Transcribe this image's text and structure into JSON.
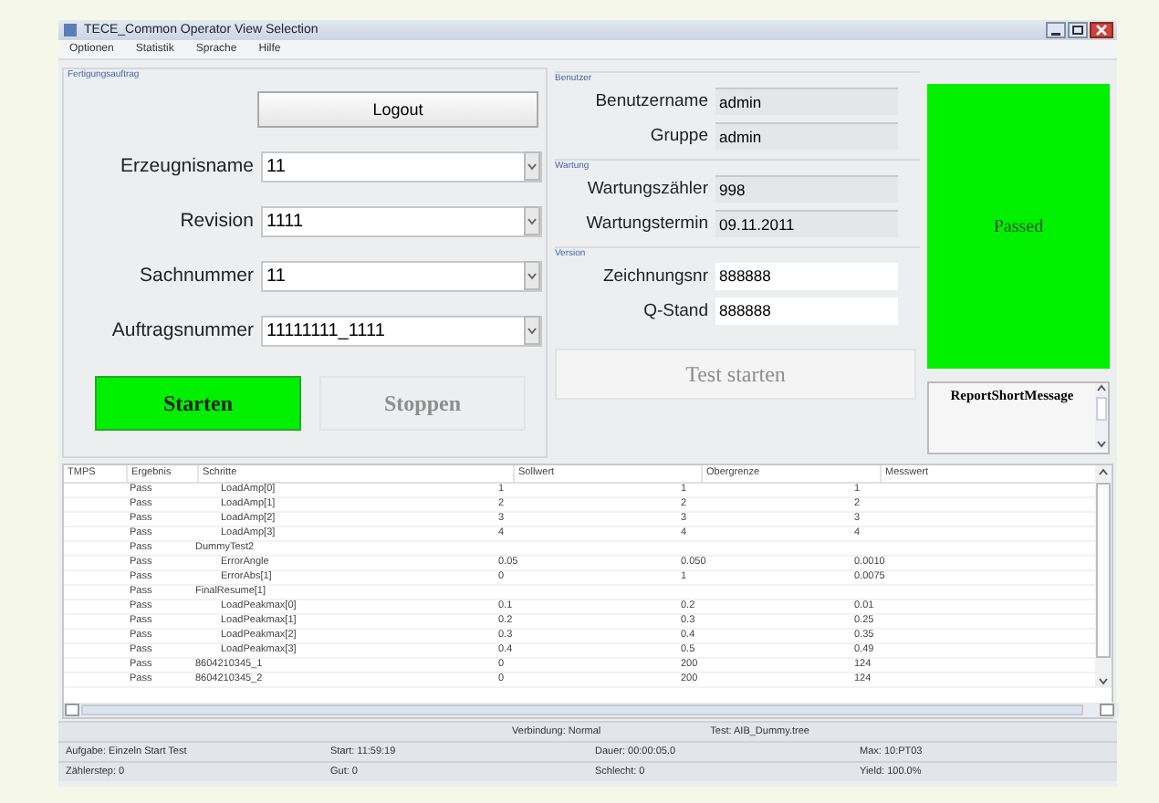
{
  "window": {
    "title": "TECE_Common Operator View Selection"
  },
  "menu": [
    "Optionen",
    "Statistik",
    "Sprache",
    "Hilfe"
  ],
  "order_group": {
    "title": "Fertigungsauftrag",
    "logout_button": "Logout",
    "fields": [
      {
        "label": "Erzeugnisname",
        "value": "11"
      },
      {
        "label": "Revision",
        "value": "1111"
      },
      {
        "label": "Sachnummer",
        "value": "11"
      },
      {
        "label": "Auftragsnummer",
        "value": "11111111_1111"
      }
    ],
    "start_button": {
      "label": "Starten",
      "disabled": false
    },
    "stop_button": {
      "label": "Stoppen",
      "disabled": true
    }
  },
  "info_groups": [
    {
      "title": "Benutzer",
      "editable": false,
      "rows": [
        {
          "label": "Benutzername",
          "value": "admin"
        },
        {
          "label": "Gruppe",
          "value": "admin"
        }
      ]
    },
    {
      "title": "Wartung",
      "editable": false,
      "rows": [
        {
          "label": "Wartungszähler",
          "value": "998"
        },
        {
          "label": "Wartungstermin",
          "value": "09.11.2011"
        }
      ]
    },
    {
      "title": "Version",
      "editable": true,
      "rows": [
        {
          "label": "Zeichnungsnr",
          "value": "888888"
        },
        {
          "label": "Q-Stand",
          "value": "888888"
        }
      ]
    }
  ],
  "test_start_button": {
    "label": "Test starten",
    "disabled": true
  },
  "result_panel": {
    "label": "Passed"
  },
  "report_message": "ReportShortMessage",
  "table": {
    "columns": [
      "TMPS",
      "Ergebnis",
      "Schritte",
      "Sollwert",
      "Obergrenze",
      "Messwert"
    ],
    "rows": [
      {
        "children": [
          {
            "result": "Pass",
            "name": "LoadAmp[0]",
            "values": [
              "1",
              "1",
              "1"
            ]
          },
          {
            "result": "Pass",
            "name": "LoadAmp[1]",
            "values": [
              "2",
              "2",
              "2"
            ]
          },
          {
            "result": "Pass",
            "name": "LoadAmp[2]",
            "values": [
              "3",
              "3",
              "3"
            ]
          },
          {
            "result": "Pass",
            "name": "LoadAmp[3]",
            "values": [
              "4",
              "4",
              "4"
            ]
          }
        ]
      },
      {
        "result": "Pass",
        "name": "DummyTest2",
        "children": [
          {
            "result": "Pass",
            "name": "ErrorAngle",
            "values": [
              "0.05",
              "0.050",
              "0.0010"
            ]
          },
          {
            "result": "Pass",
            "name": "ErrorAbs[1]",
            "values": [
              "0",
              "1",
              "0.0075"
            ]
          }
        ]
      },
      {
        "result": "Pass",
        "name": "FinalResume[1]",
        "children": [
          {
            "result": "Pass",
            "name": "LoadPeakmax[0]",
            "values": [
              "0.1",
              "0.2",
              "0.01"
            ]
          },
          {
            "result": "Pass",
            "name": "LoadPeakmax[1]",
            "values": [
              "0.2",
              "0.3",
              "0.25"
            ]
          },
          {
            "result": "Pass",
            "name": "LoadPeakmax[2]",
            "values": [
              "0.3",
              "0.4",
              "0.35"
            ]
          },
          {
            "result": "Pass",
            "name": "LoadPeakmax[3]",
            "values": [
              "0.4",
              "0.5",
              "0.49"
            ]
          }
        ]
      },
      {
        "result": "Pass",
        "name": "8604210345_1",
        "values": [
          "0",
          "200",
          "124"
        ]
      },
      {
        "result": "Pass",
        "name": "8604210345_2",
        "values": [
          "0",
          "200",
          "124"
        ]
      }
    ]
  },
  "status_bar": [
    [
      "Verbindung: Normal",
      "Test: AIB_Dummy.tree"
    ],
    [
      "Aufgabe: Einzeln Start Test",
      "Start: 11:59:19",
      "Dauer: 00:00:05.0",
      "Max: 10:PT03"
    ],
    [
      "Zählerstep: 0",
      "Gut: 0",
      "Schlecht: 0",
      "Yield: 100.0%"
    ]
  ]
}
